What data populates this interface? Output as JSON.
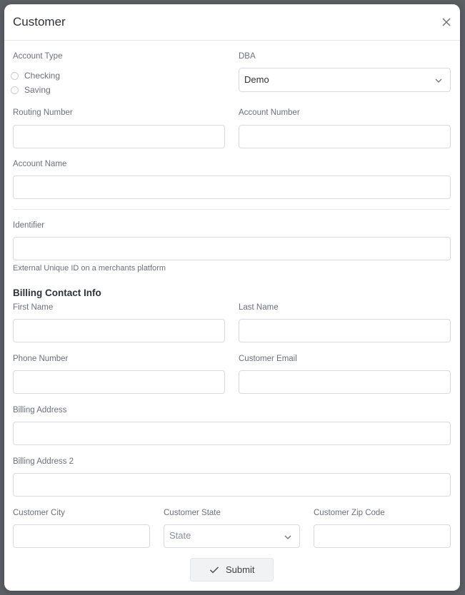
{
  "modal": {
    "title": "Customer"
  },
  "icons": {
    "close": "close-icon",
    "chevron": "chevron-down-icon",
    "check": "check-icon"
  },
  "account_type": {
    "label": "Account Type",
    "options": [
      "Checking",
      "Saving"
    ],
    "selected": null
  },
  "dba": {
    "label": "DBA",
    "value": "Demo"
  },
  "routing_number": {
    "label": "Routing Number",
    "value": ""
  },
  "account_number": {
    "label": "Account Number",
    "value": ""
  },
  "account_name": {
    "label": "Account Name",
    "value": ""
  },
  "identifier": {
    "label": "Identifier",
    "value": "",
    "helper": "External Unique ID on a merchants platform"
  },
  "billing": {
    "section_title": "Billing Contact Info",
    "first_name": {
      "label": "First Name",
      "value": ""
    },
    "last_name": {
      "label": "Last Name",
      "value": ""
    },
    "phone": {
      "label": "Phone Number",
      "value": ""
    },
    "email": {
      "label": "Customer Email",
      "value": ""
    },
    "address": {
      "label": "Billing Address",
      "value": ""
    },
    "address2": {
      "label": "Billing Address 2",
      "value": ""
    },
    "city": {
      "label": "Customer City",
      "value": ""
    },
    "state": {
      "label": "Customer State",
      "placeholder": "State"
    },
    "zip": {
      "label": "Customer Zip Code",
      "value": ""
    }
  },
  "submit": {
    "label": "Submit"
  }
}
